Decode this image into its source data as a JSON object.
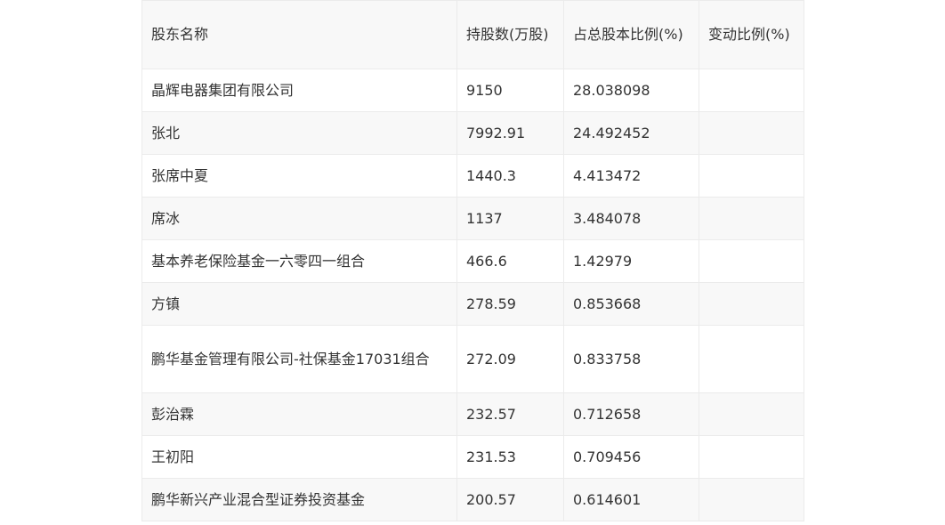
{
  "table": {
    "headers": [
      "股东名称",
      "持股数(万股)",
      "占总股本比例(%)",
      "变动比例(%)"
    ],
    "rows": [
      {
        "name": "晶辉电器集团有限公司",
        "shares": "9150",
        "ratio": "28.038098",
        "change": ""
      },
      {
        "name": "张北",
        "shares": "7992.91",
        "ratio": "24.492452",
        "change": ""
      },
      {
        "name": "张席中夏",
        "shares": "1440.3",
        "ratio": "4.413472",
        "change": ""
      },
      {
        "name": "席冰",
        "shares": "1137",
        "ratio": "3.484078",
        "change": ""
      },
      {
        "name": "基本养老保险基金一六零四一组合",
        "shares": "466.6",
        "ratio": "1.42979",
        "change": ""
      },
      {
        "name": "方镇",
        "shares": "278.59",
        "ratio": "0.853668",
        "change": ""
      },
      {
        "name": "鹏华基金管理有限公司-社保基金17031组合",
        "shares": "272.09",
        "ratio": "0.833758",
        "change": ""
      },
      {
        "name": "彭治霖",
        "shares": "232.57",
        "ratio": "0.712658",
        "change": ""
      },
      {
        "name": "王初阳",
        "shares": "231.53",
        "ratio": "0.709456",
        "change": ""
      },
      {
        "name": "鹏华新兴产业混合型证券投资基金",
        "shares": "200.57",
        "ratio": "0.614601",
        "change": ""
      }
    ]
  }
}
